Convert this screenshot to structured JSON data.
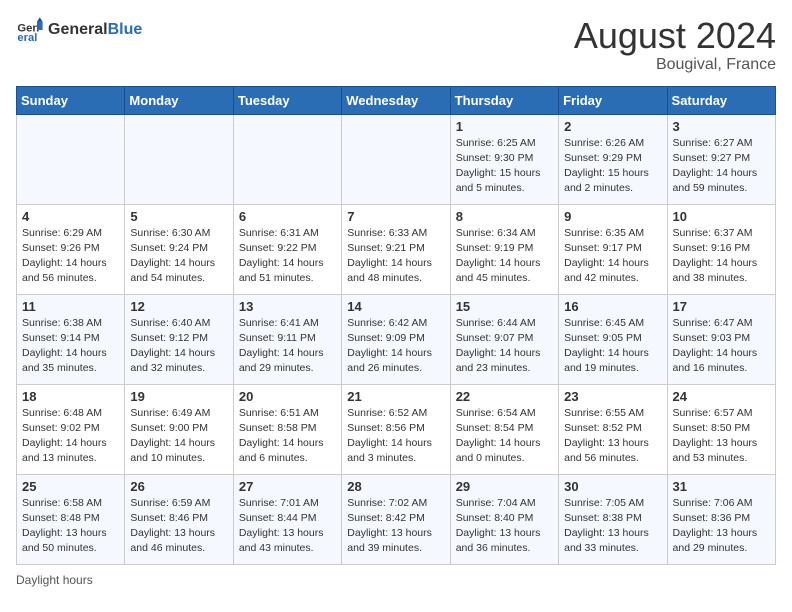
{
  "header": {
    "logo_general": "General",
    "logo_blue": "Blue",
    "main_title": "August 2024",
    "subtitle": "Bougival, France"
  },
  "days_of_week": [
    "Sunday",
    "Monday",
    "Tuesday",
    "Wednesday",
    "Thursday",
    "Friday",
    "Saturday"
  ],
  "weeks": [
    [
      {
        "date": "",
        "info": ""
      },
      {
        "date": "",
        "info": ""
      },
      {
        "date": "",
        "info": ""
      },
      {
        "date": "",
        "info": ""
      },
      {
        "date": "1",
        "info": "Sunrise: 6:25 AM\nSunset: 9:30 PM\nDaylight: 15 hours\nand 5 minutes."
      },
      {
        "date": "2",
        "info": "Sunrise: 6:26 AM\nSunset: 9:29 PM\nDaylight: 15 hours\nand 2 minutes."
      },
      {
        "date": "3",
        "info": "Sunrise: 6:27 AM\nSunset: 9:27 PM\nDaylight: 14 hours\nand 59 minutes."
      }
    ],
    [
      {
        "date": "4",
        "info": "Sunrise: 6:29 AM\nSunset: 9:26 PM\nDaylight: 14 hours\nand 56 minutes."
      },
      {
        "date": "5",
        "info": "Sunrise: 6:30 AM\nSunset: 9:24 PM\nDaylight: 14 hours\nand 54 minutes."
      },
      {
        "date": "6",
        "info": "Sunrise: 6:31 AM\nSunset: 9:22 PM\nDaylight: 14 hours\nand 51 minutes."
      },
      {
        "date": "7",
        "info": "Sunrise: 6:33 AM\nSunset: 9:21 PM\nDaylight: 14 hours\nand 48 minutes."
      },
      {
        "date": "8",
        "info": "Sunrise: 6:34 AM\nSunset: 9:19 PM\nDaylight: 14 hours\nand 45 minutes."
      },
      {
        "date": "9",
        "info": "Sunrise: 6:35 AM\nSunset: 9:17 PM\nDaylight: 14 hours\nand 42 minutes."
      },
      {
        "date": "10",
        "info": "Sunrise: 6:37 AM\nSunset: 9:16 PM\nDaylight: 14 hours\nand 38 minutes."
      }
    ],
    [
      {
        "date": "11",
        "info": "Sunrise: 6:38 AM\nSunset: 9:14 PM\nDaylight: 14 hours\nand 35 minutes."
      },
      {
        "date": "12",
        "info": "Sunrise: 6:40 AM\nSunset: 9:12 PM\nDaylight: 14 hours\nand 32 minutes."
      },
      {
        "date": "13",
        "info": "Sunrise: 6:41 AM\nSunset: 9:11 PM\nDaylight: 14 hours\nand 29 minutes."
      },
      {
        "date": "14",
        "info": "Sunrise: 6:42 AM\nSunset: 9:09 PM\nDaylight: 14 hours\nand 26 minutes."
      },
      {
        "date": "15",
        "info": "Sunrise: 6:44 AM\nSunset: 9:07 PM\nDaylight: 14 hours\nand 23 minutes."
      },
      {
        "date": "16",
        "info": "Sunrise: 6:45 AM\nSunset: 9:05 PM\nDaylight: 14 hours\nand 19 minutes."
      },
      {
        "date": "17",
        "info": "Sunrise: 6:47 AM\nSunset: 9:03 PM\nDaylight: 14 hours\nand 16 minutes."
      }
    ],
    [
      {
        "date": "18",
        "info": "Sunrise: 6:48 AM\nSunset: 9:02 PM\nDaylight: 14 hours\nand 13 minutes."
      },
      {
        "date": "19",
        "info": "Sunrise: 6:49 AM\nSunset: 9:00 PM\nDaylight: 14 hours\nand 10 minutes."
      },
      {
        "date": "20",
        "info": "Sunrise: 6:51 AM\nSunset: 8:58 PM\nDaylight: 14 hours\nand 6 minutes."
      },
      {
        "date": "21",
        "info": "Sunrise: 6:52 AM\nSunset: 8:56 PM\nDaylight: 14 hours\nand 3 minutes."
      },
      {
        "date": "22",
        "info": "Sunrise: 6:54 AM\nSunset: 8:54 PM\nDaylight: 14 hours\nand 0 minutes."
      },
      {
        "date": "23",
        "info": "Sunrise: 6:55 AM\nSunset: 8:52 PM\nDaylight: 13 hours\nand 56 minutes."
      },
      {
        "date": "24",
        "info": "Sunrise: 6:57 AM\nSunset: 8:50 PM\nDaylight: 13 hours\nand 53 minutes."
      }
    ],
    [
      {
        "date": "25",
        "info": "Sunrise: 6:58 AM\nSunset: 8:48 PM\nDaylight: 13 hours\nand 50 minutes."
      },
      {
        "date": "26",
        "info": "Sunrise: 6:59 AM\nSunset: 8:46 PM\nDaylight: 13 hours\nand 46 minutes."
      },
      {
        "date": "27",
        "info": "Sunrise: 7:01 AM\nSunset: 8:44 PM\nDaylight: 13 hours\nand 43 minutes."
      },
      {
        "date": "28",
        "info": "Sunrise: 7:02 AM\nSunset: 8:42 PM\nDaylight: 13 hours\nand 39 minutes."
      },
      {
        "date": "29",
        "info": "Sunrise: 7:04 AM\nSunset: 8:40 PM\nDaylight: 13 hours\nand 36 minutes."
      },
      {
        "date": "30",
        "info": "Sunrise: 7:05 AM\nSunset: 8:38 PM\nDaylight: 13 hours\nand 33 minutes."
      },
      {
        "date": "31",
        "info": "Sunrise: 7:06 AM\nSunset: 8:36 PM\nDaylight: 13 hours\nand 29 minutes."
      }
    ]
  ],
  "footer": {
    "note": "Daylight hours"
  }
}
